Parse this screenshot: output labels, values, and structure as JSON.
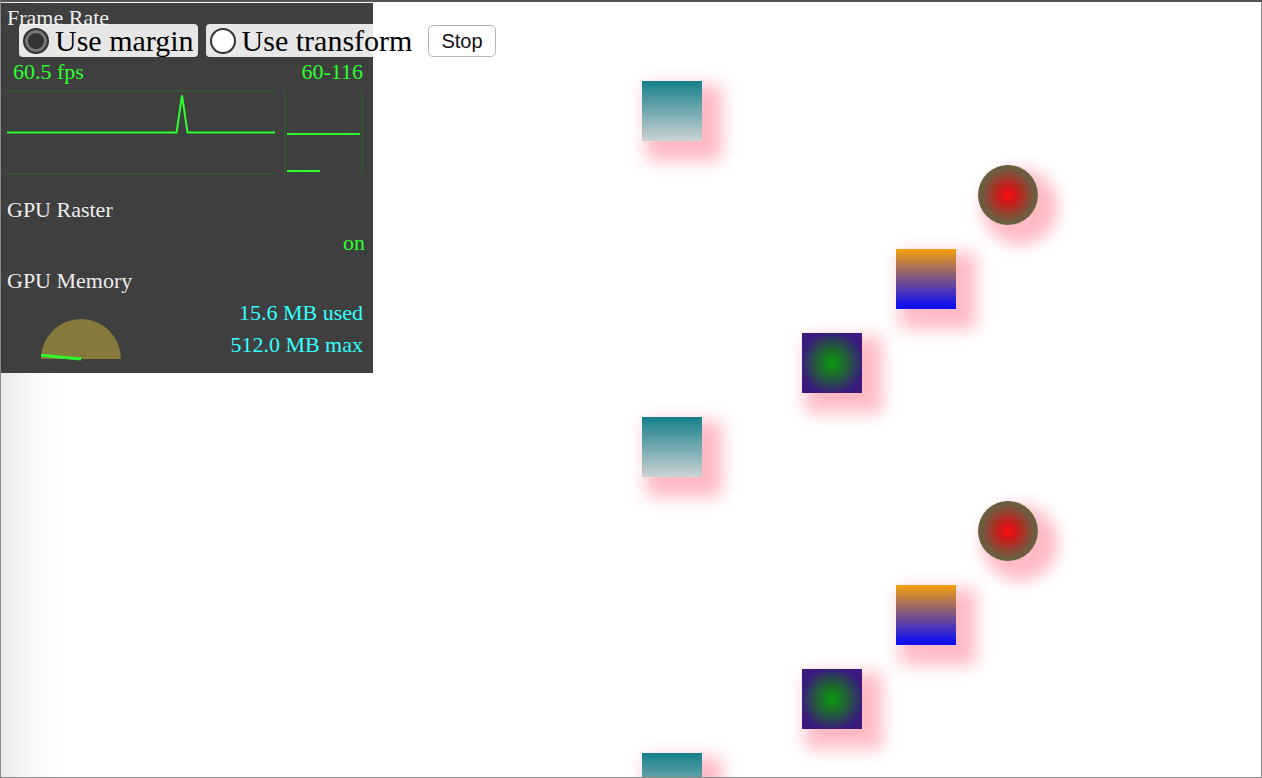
{
  "hud": {
    "frame_rate": {
      "title": "Frame Rate",
      "fps": "60.5 fps",
      "range": "60-116",
      "series": [
        60,
        60,
        60,
        60,
        60,
        60,
        60,
        60,
        60,
        60,
        60,
        60,
        60,
        60,
        60,
        60,
        60,
        60,
        60,
        60,
        60,
        60,
        60,
        60,
        60,
        60,
        60,
        60,
        60,
        60,
        60,
        60,
        116,
        60,
        60,
        60,
        60,
        60,
        60,
        60,
        60,
        60,
        60,
        60,
        60,
        60,
        60,
        60,
        60,
        60
      ],
      "histogram": [
        {
          "level": 1.0
        },
        {
          "level": 0.45
        }
      ]
    },
    "gpu_raster": {
      "title": "GPU Raster",
      "value": "on"
    },
    "gpu_memory": {
      "title": "GPU Memory",
      "used": "15.6 MB used",
      "max": "512.0 MB max",
      "level": 0.03
    }
  },
  "controls": {
    "radios": [
      {
        "label": "Use margin",
        "selected": true
      },
      {
        "label": "Use transform",
        "selected": false
      }
    ],
    "button": "Stop"
  },
  "shapes": [
    {
      "kind": "teal"
    },
    {
      "kind": "red"
    },
    {
      "kind": "orange"
    },
    {
      "kind": "green"
    },
    {
      "kind": "teal"
    },
    {
      "kind": "red"
    },
    {
      "kind": "orange"
    },
    {
      "kind": "green"
    },
    {
      "kind": "teal"
    }
  ]
}
